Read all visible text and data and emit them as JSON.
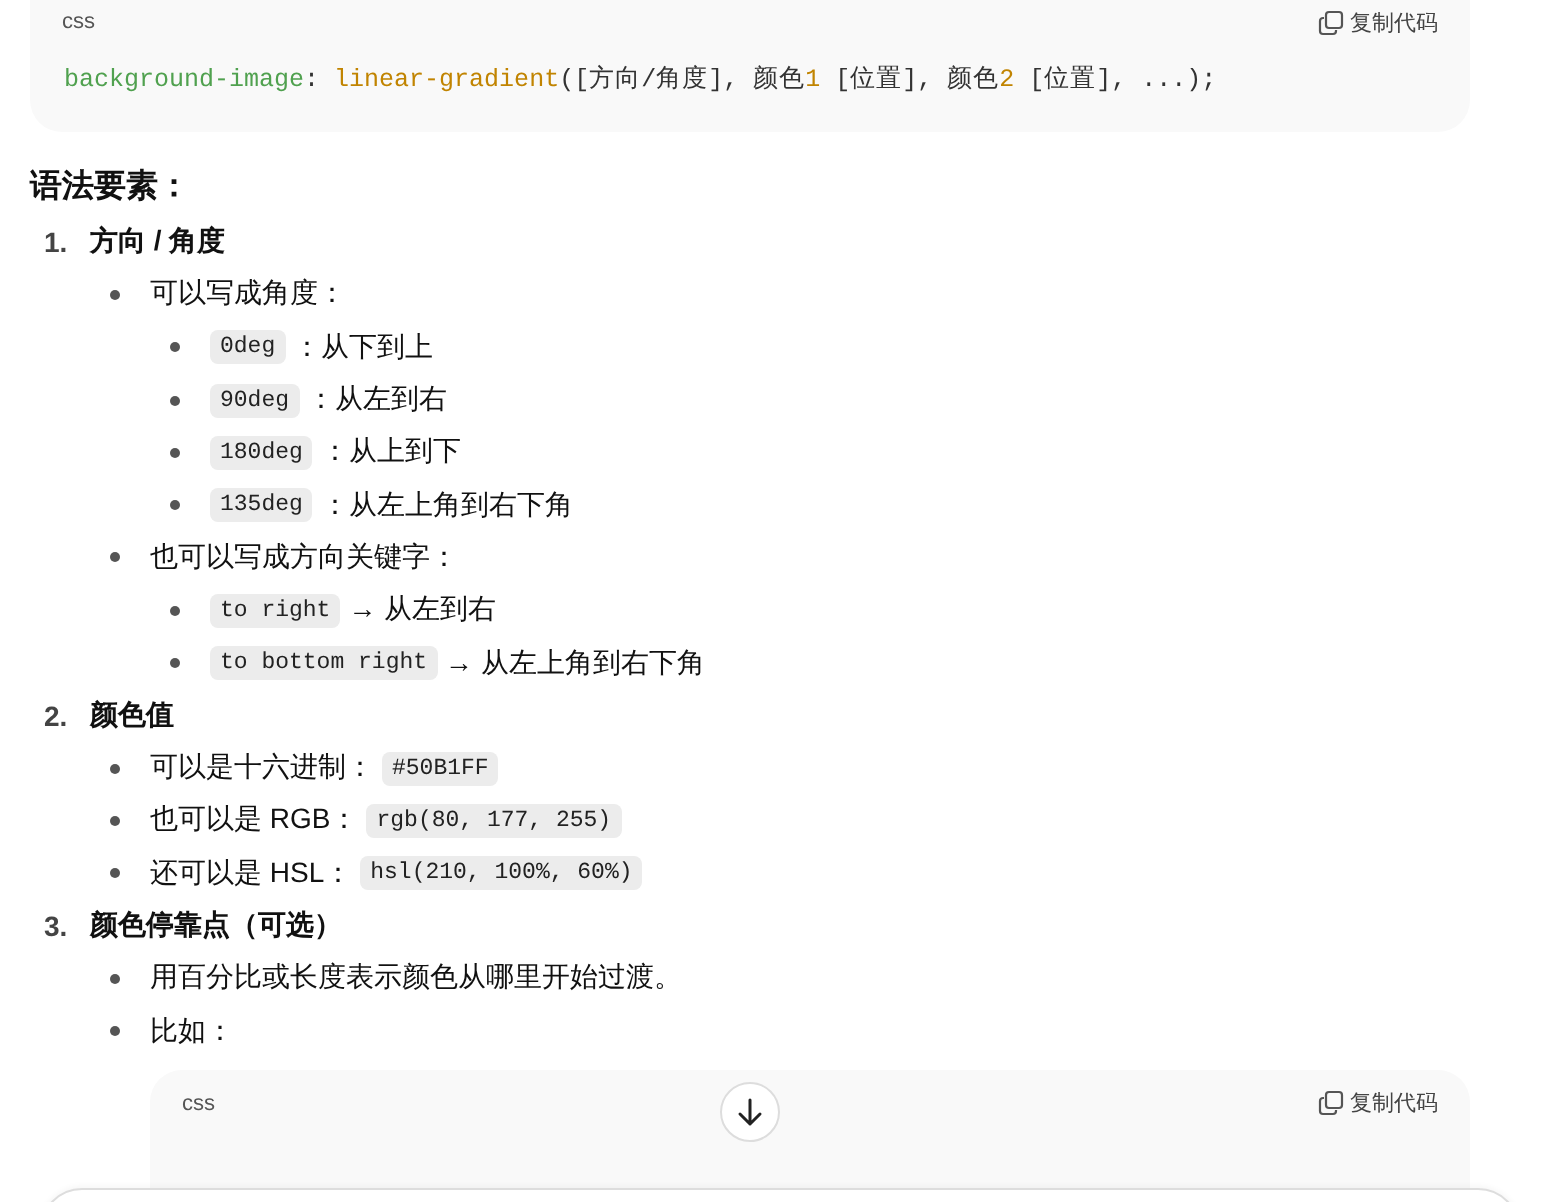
{
  "code_block_top": {
    "language": "css",
    "copy_label": "复制代码",
    "tokens": [
      {
        "kind": "property",
        "text": "background-image"
      },
      {
        "kind": "plain",
        "text": ": "
      },
      {
        "kind": "function",
        "text": "linear-gradient"
      },
      {
        "kind": "plain",
        "text": "([方向/角度], 颜色"
      },
      {
        "kind": "number",
        "text": "1"
      },
      {
        "kind": "plain",
        "text": " [位置], 颜色"
      },
      {
        "kind": "number",
        "text": "2"
      },
      {
        "kind": "plain",
        "text": " [位置], ...);"
      }
    ]
  },
  "heading": "语法要素：",
  "sections": [
    {
      "number": "1.",
      "title": "方向 / 角度",
      "items": [
        {
          "segments": [
            {
              "kind": "text",
              "text": "可以写成角度："
            }
          ],
          "children": [
            {
              "segments": [
                {
                  "kind": "code",
                  "text": "0deg"
                },
                {
                  "kind": "text",
                  "text": "：从下到上"
                }
              ]
            },
            {
              "segments": [
                {
                  "kind": "code",
                  "text": "90deg"
                },
                {
                  "kind": "text",
                  "text": "：从左到右"
                }
              ]
            },
            {
              "segments": [
                {
                  "kind": "code",
                  "text": "180deg"
                },
                {
                  "kind": "text",
                  "text": "：从上到下"
                }
              ]
            },
            {
              "segments": [
                {
                  "kind": "code",
                  "text": "135deg"
                },
                {
                  "kind": "text",
                  "text": "：从左上角到右下角"
                }
              ]
            }
          ]
        },
        {
          "segments": [
            {
              "kind": "text",
              "text": "也可以写成方向关键字："
            }
          ],
          "children": [
            {
              "segments": [
                {
                  "kind": "code",
                  "text": "to right"
                },
                {
                  "kind": "text",
                  "text": "→ 从左到右"
                }
              ]
            },
            {
              "segments": [
                {
                  "kind": "code",
                  "text": "to bottom right"
                },
                {
                  "kind": "text",
                  "text": "→ 从左上角到右下角"
                }
              ]
            }
          ]
        }
      ]
    },
    {
      "number": "2.",
      "title": "颜色值",
      "items": [
        {
          "segments": [
            {
              "kind": "text",
              "text": "可以是十六进制："
            },
            {
              "kind": "code",
              "text": "#50B1FF"
            }
          ]
        },
        {
          "segments": [
            {
              "kind": "text",
              "text": "也可以是 RGB："
            },
            {
              "kind": "code",
              "text": "rgb(80, 177, 255)"
            }
          ]
        },
        {
          "segments": [
            {
              "kind": "text",
              "text": "还可以是 HSL："
            },
            {
              "kind": "code",
              "text": "hsl(210, 100%, 60%)"
            }
          ]
        }
      ]
    },
    {
      "number": "3.",
      "title": "颜色停靠点（可选）",
      "items": [
        {
          "segments": [
            {
              "kind": "text",
              "text": "用百分比或长度表示颜色从哪里开始过渡。"
            }
          ]
        },
        {
          "segments": [
            {
              "kind": "text",
              "text": "比如："
            }
          ]
        }
      ]
    }
  ],
  "code_block_bottom": {
    "language": "css",
    "copy_label": "复制代码"
  }
}
